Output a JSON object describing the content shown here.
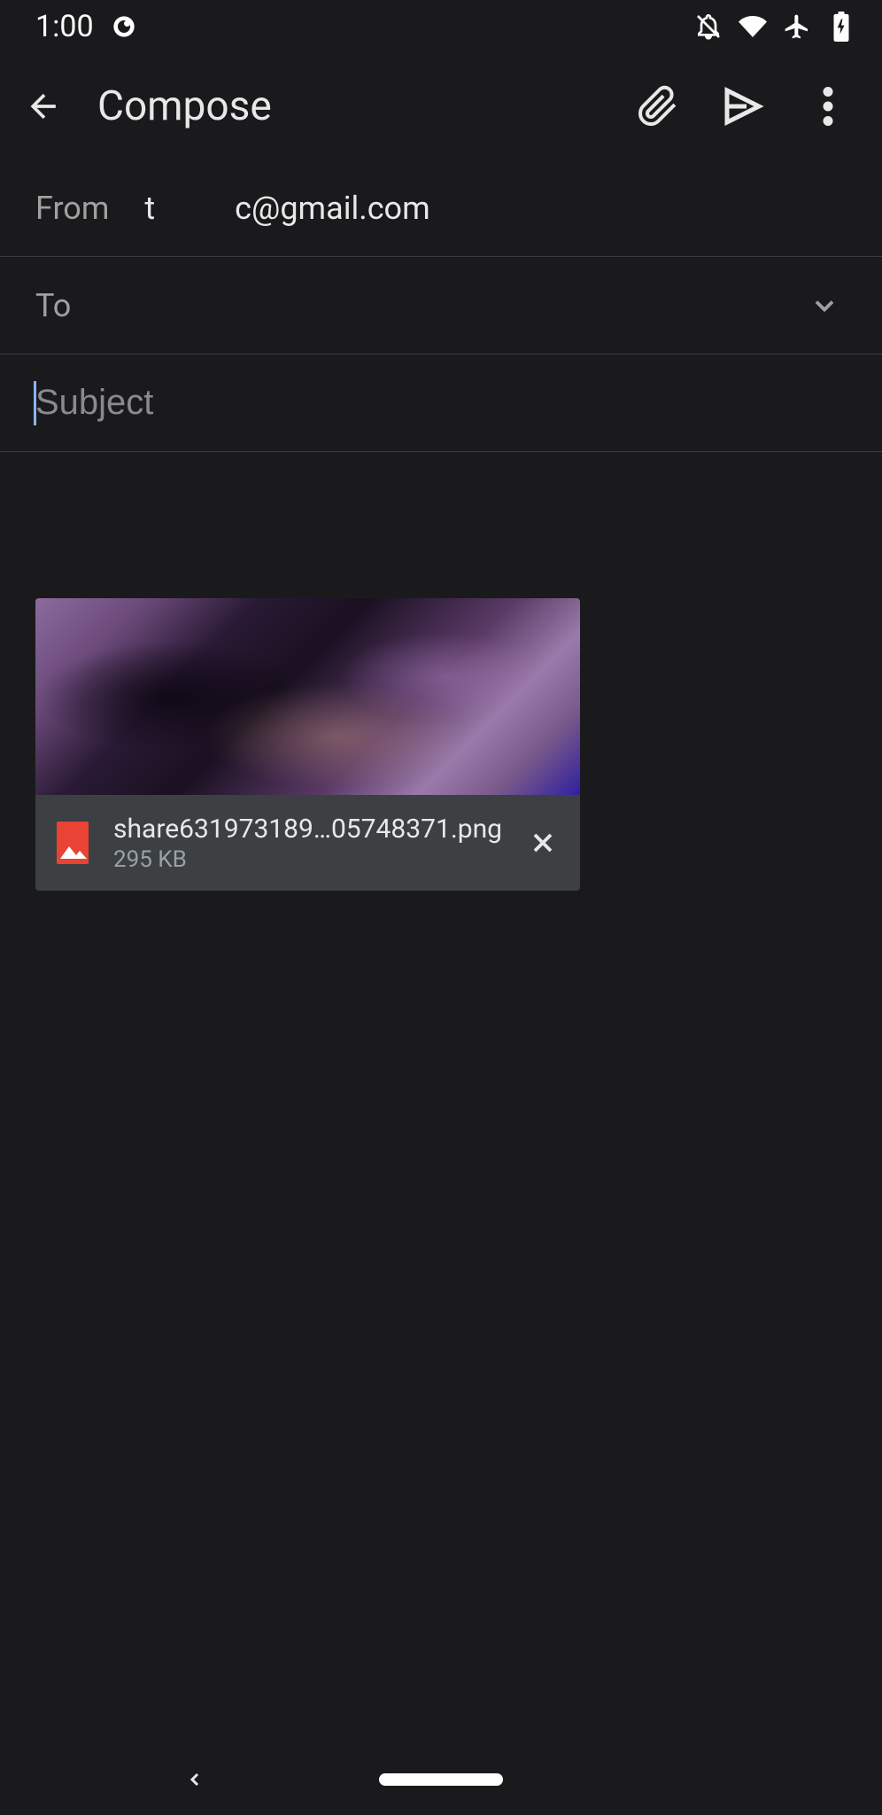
{
  "status": {
    "time": "1:00"
  },
  "header": {
    "title": "Compose"
  },
  "from": {
    "label": "From",
    "value_part1": "t",
    "value_part2": "c@gmail.com"
  },
  "to": {
    "label": "To"
  },
  "subject": {
    "placeholder": "Subject",
    "value": ""
  },
  "attachment": {
    "filename": "share631973189…05748371.png",
    "filesize": "295 KB"
  }
}
